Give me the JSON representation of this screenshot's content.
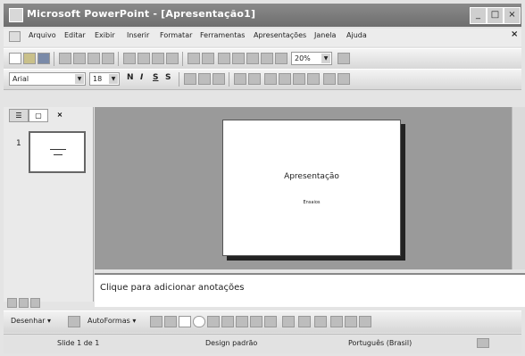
{
  "window": {
    "title": "Microsoft PowerPoint - [Apresentação1]",
    "minimize_label": "_",
    "maximize_label": "□",
    "close_label": "×"
  },
  "menu": {
    "items": [
      "Arquivo",
      "Editar",
      "Exibir",
      "Inserir",
      "Formatar",
      "Ferramentas",
      "Apresentações",
      "Janela",
      "Ajuda"
    ],
    "close_doc": "×"
  },
  "toolbar": {
    "zoom": "20%"
  },
  "format_toolbar": {
    "font": "Arial",
    "size": "18",
    "bold": "N",
    "italic": "I",
    "underline": "S",
    "shadow": "S"
  },
  "left_pane": {
    "tab_outline": "☰",
    "tab_slides": "▢",
    "tab_close": "×",
    "slide_number": "1"
  },
  "slide": {
    "title": "Apresentação",
    "subtitle": "Ensaios"
  },
  "notes": {
    "placeholder": "Clique para adicionar anotações"
  },
  "drawing_toolbar": {
    "draw_label": "Desenhar ▾",
    "autoshapes_label": "AutoFormas ▾"
  },
  "statusbar": {
    "slide_info": "Slide 1 de 1",
    "design": "Design padrão",
    "language": "Português (Brasil)"
  }
}
